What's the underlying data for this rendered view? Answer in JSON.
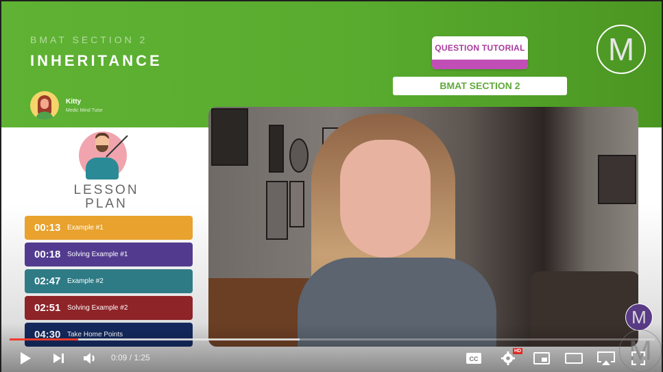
{
  "header": {
    "subtitle": "BMAT SECTION 2",
    "title": "INHERITANCE",
    "tutor_name": "Kitty",
    "tutor_role": "Medic Mind Tutor",
    "tag_type": "QUESTION TUTORIAL",
    "tag_section": "BMAT SECTION 2",
    "logo_letter": "M"
  },
  "lesson": {
    "heading_line1": "LESSON",
    "heading_line2": "PLAN",
    "items": [
      {
        "time": "00:13",
        "label": "Example #1",
        "color": "#e8a22d"
      },
      {
        "time": "00:18",
        "label": "Solving Example #1",
        "color": "#523b8f"
      },
      {
        "time": "02:47",
        "label": "Example #2",
        "color": "#2e7b86"
      },
      {
        "time": "02:51",
        "label": "Solving Example #2",
        "color": "#8e2328"
      },
      {
        "time": "04:30",
        "label": "Take Home Points",
        "color": "#14295e"
      }
    ]
  },
  "player": {
    "current_time": "0:09",
    "duration": "1:25",
    "time_display": "0:09 / 1:25",
    "played_fraction": 0.106,
    "buffered_fraction": 0.45,
    "hd_badge": "HD",
    "accent_color": "#f03b2a",
    "controls": [
      "play-icon",
      "next-icon",
      "volume-icon",
      "captions-icon",
      "settings-icon",
      "miniplayer-icon",
      "theater-icon",
      "airplay-icon",
      "fullscreen-icon"
    ]
  }
}
